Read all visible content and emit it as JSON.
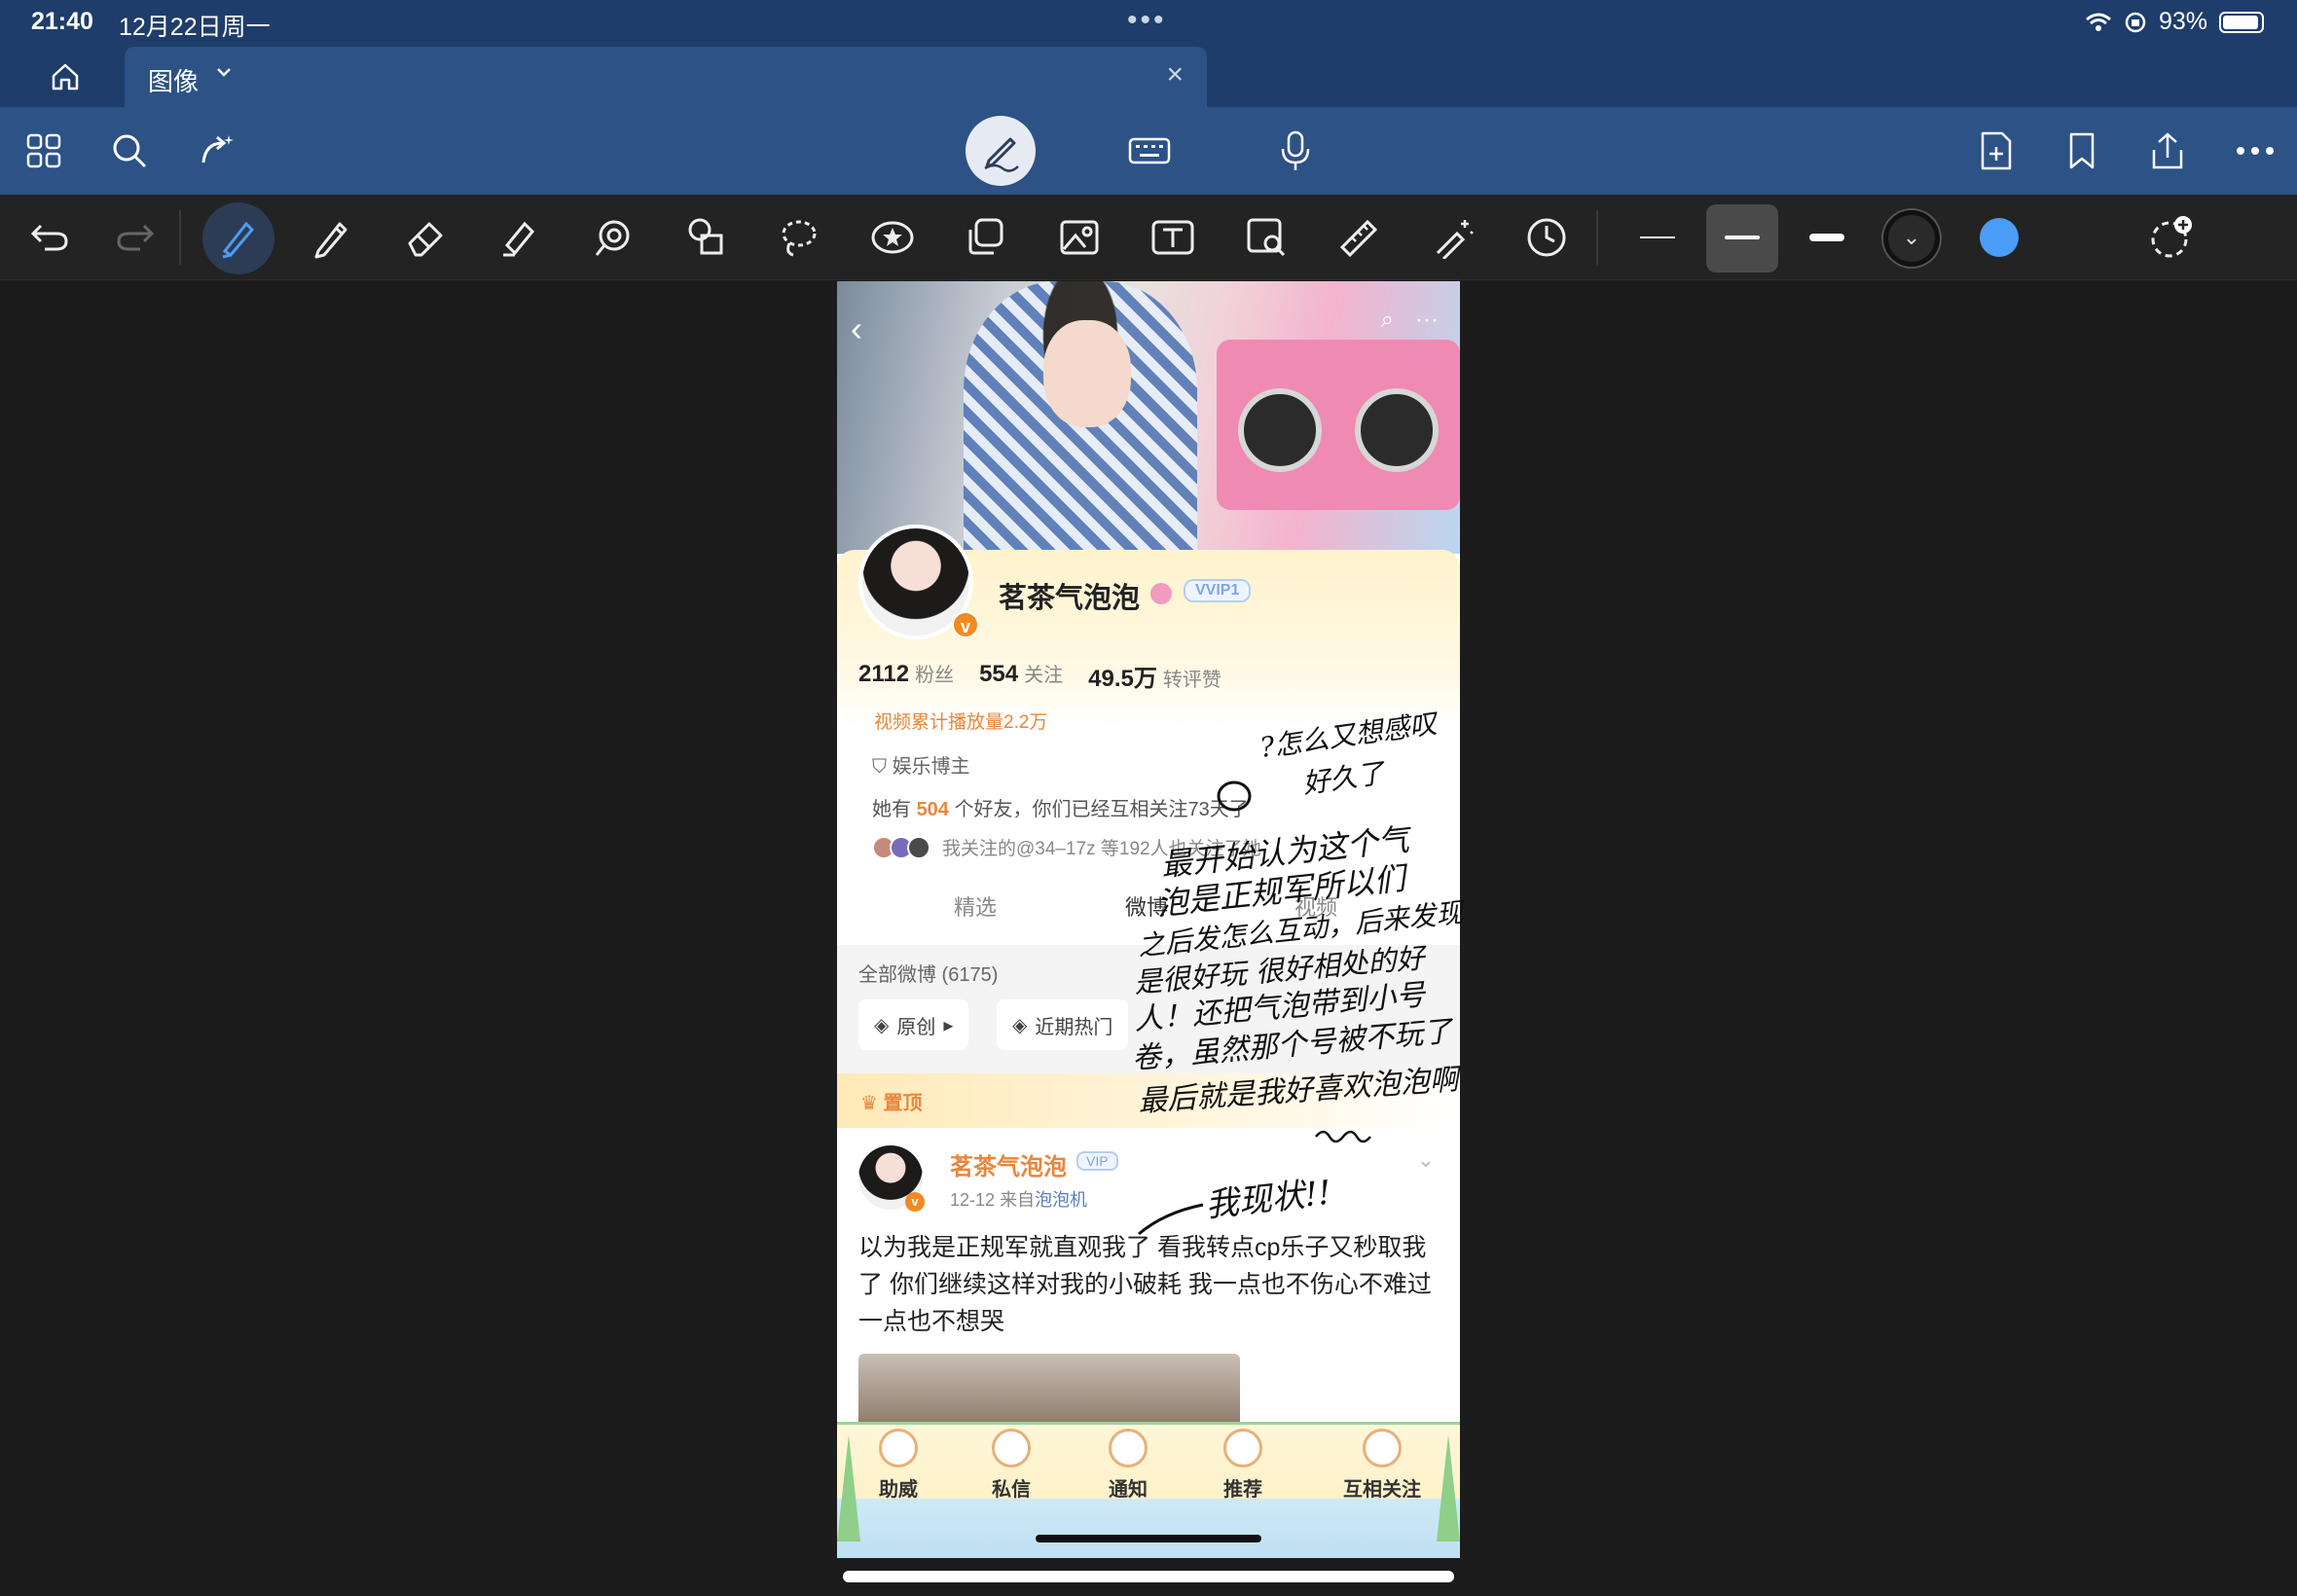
{
  "status": {
    "time": "21:40",
    "date": "12月22日周一",
    "battery": "93%"
  },
  "tab": {
    "title": "图像",
    "close": "×"
  },
  "profile": {
    "nickname": "茗茶气泡泡",
    "vip_label": "VVIP1",
    "stats": [
      {
        "value": "2112",
        "unit": "粉丝"
      },
      {
        "value": "554",
        "unit": "关注"
      },
      {
        "value": "49.5万",
        "unit": "转评赞"
      }
    ],
    "video_plays": "视频累计播放量2.2万",
    "role": "娱乐博主",
    "friends_prefix": "她有",
    "friends_count": "504",
    "friends_suffix": "个好友，你们已经互相关注",
    "friends_days": "73",
    "friends_end": "天了",
    "follow_common": "我关注的@34–17z 等192人也关注了她",
    "tabs": [
      "精选",
      "微博",
      "视频"
    ]
  },
  "feed": {
    "all_label": "全部微博 (6175)",
    "chips": [
      "原创",
      "近期热门"
    ],
    "pinned_label": "置顶"
  },
  "post": {
    "name": "茗茶气泡泡",
    "date": "12-12",
    "source_prefix": "来自",
    "source": "泡泡机",
    "text": "以为我是正规军就直观我了 看我转点cp乐子又秒取我了 你们继续这样对我的小破耗 我一点也不伤心不难过一点也不想哭"
  },
  "bottom_nav": [
    "助威",
    "私信",
    "通知",
    "推荐",
    "互相关注"
  ],
  "ink_notes": {
    "note1_line1": "?怎么又想感叹",
    "note1_line2": "好久了",
    "note2": [
      "最开始认为这个气",
      "泡是正规军所以们",
      "之后发怎么互动，后来发现",
      "是很好玩 很好相处的好",
      "人！还把气泡带到小号",
      "卷，虽然那个号被不玩了",
      "最后就是我好喜欢泡泡啊"
    ],
    "note3": "我现状!!"
  },
  "colors": {
    "accent_orange": "#e8863c",
    "chrome_blue": "#2c5286",
    "pen_blue": "#4b9cf5"
  }
}
